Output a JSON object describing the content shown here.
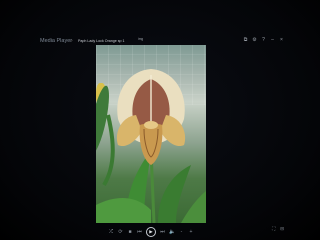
{
  "window": {
    "app_title": "Media Player",
    "separator": "»",
    "file_name": "Paph Lady Lock Orange sp 1",
    "top_label": "img"
  },
  "window_controls": {
    "restore": "⧉",
    "settings": "⚙",
    "help": "?",
    "minimize": "–",
    "close": "×"
  },
  "player_controls": {
    "shuffle": "⤮",
    "repeat": "⟳",
    "stop": "■",
    "previous": "⏮",
    "play": "▶",
    "next": "⏭",
    "mute": "🔈",
    "vol_down": "-",
    "vol_up": "+"
  },
  "right_controls": {
    "fullscreen": "⛶",
    "switch_view": "⊟"
  },
  "colors": {
    "petal": "#e8dcbc",
    "spots": "#6b2a1a",
    "pouch": "#c89a56",
    "leaf": "#3f8c34"
  }
}
